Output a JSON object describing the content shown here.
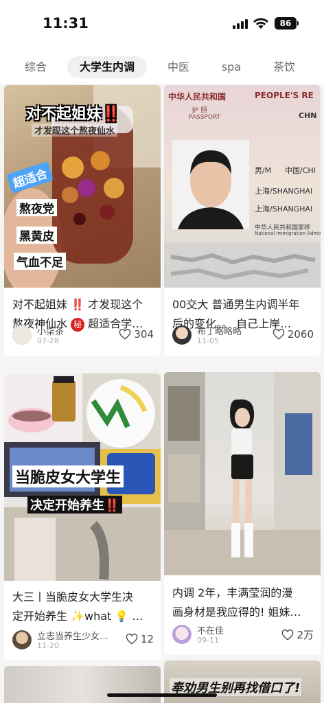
{
  "status_bar": {
    "time": "11:31",
    "battery": "86"
  },
  "tabs": [
    {
      "label": "综合"
    },
    {
      "label": "大学生内调"
    },
    {
      "label": "中医"
    },
    {
      "label": "spa"
    },
    {
      "label": "茶饮"
    }
  ],
  "cards": [
    {
      "overlay": {
        "headline": "对不起姐妹‼️",
        "sub": "才发现这个熬夜仙水",
        "tag": "超适合",
        "lines": [
          "熬夜党",
          "黑黄皮",
          "气血不足"
        ]
      },
      "title_line1": "对不起姐妹 ‼️ 才发现这个",
      "title_line2a": "熬夜神仙水",
      "title_secret": "秘",
      "title_line2b": "超适合学…",
      "author": "小柒茶",
      "date": "07-28",
      "likes": "304"
    },
    {
      "overlay": {
        "header_cn": "中华人民共和国",
        "header_en": "PEOPLE'S RE",
        "passport_cn": "护 照",
        "passport_en": "PASSPORT",
        "country": "CHN",
        "sex": "男/M",
        "nationality": "中国/CHI",
        "place1": "上海/SHANGHAI",
        "place2": "上海/SHANGHAI",
        "authority": "中华人民共和国家移",
        "authority_en": "National Immigration Administrat"
      },
      "title_line1": "00交大 普通男生内调半年",
      "title_line2": "后的变化。。 自己上岸…",
      "author": "布丁略略略",
      "date": "11-05",
      "likes": "2060"
    },
    {
      "overlay": {
        "line1": "当脆皮女大学生",
        "line2": "决定开始养生‼️"
      },
      "title_line1": "大三丨当脆皮女大学生决",
      "title_line2": "定开始养生 ✨what 💡 …",
      "author": "立志当养生少女…",
      "date": "11-20",
      "likes": "12"
    },
    {
      "title_line1": "内调 2年，丰满莹润的漫",
      "title_line2": "画身材是我应得的! 姐妹…",
      "author": "不在佳",
      "date": "09-11",
      "likes": "2万"
    },
    {
      "overlay": {
        "line1": "奉劝男生别再找借口了!"
      }
    }
  ],
  "colors": {
    "accent_red": "#d8201b",
    "tab_active_bg": "#f0f0f0"
  }
}
